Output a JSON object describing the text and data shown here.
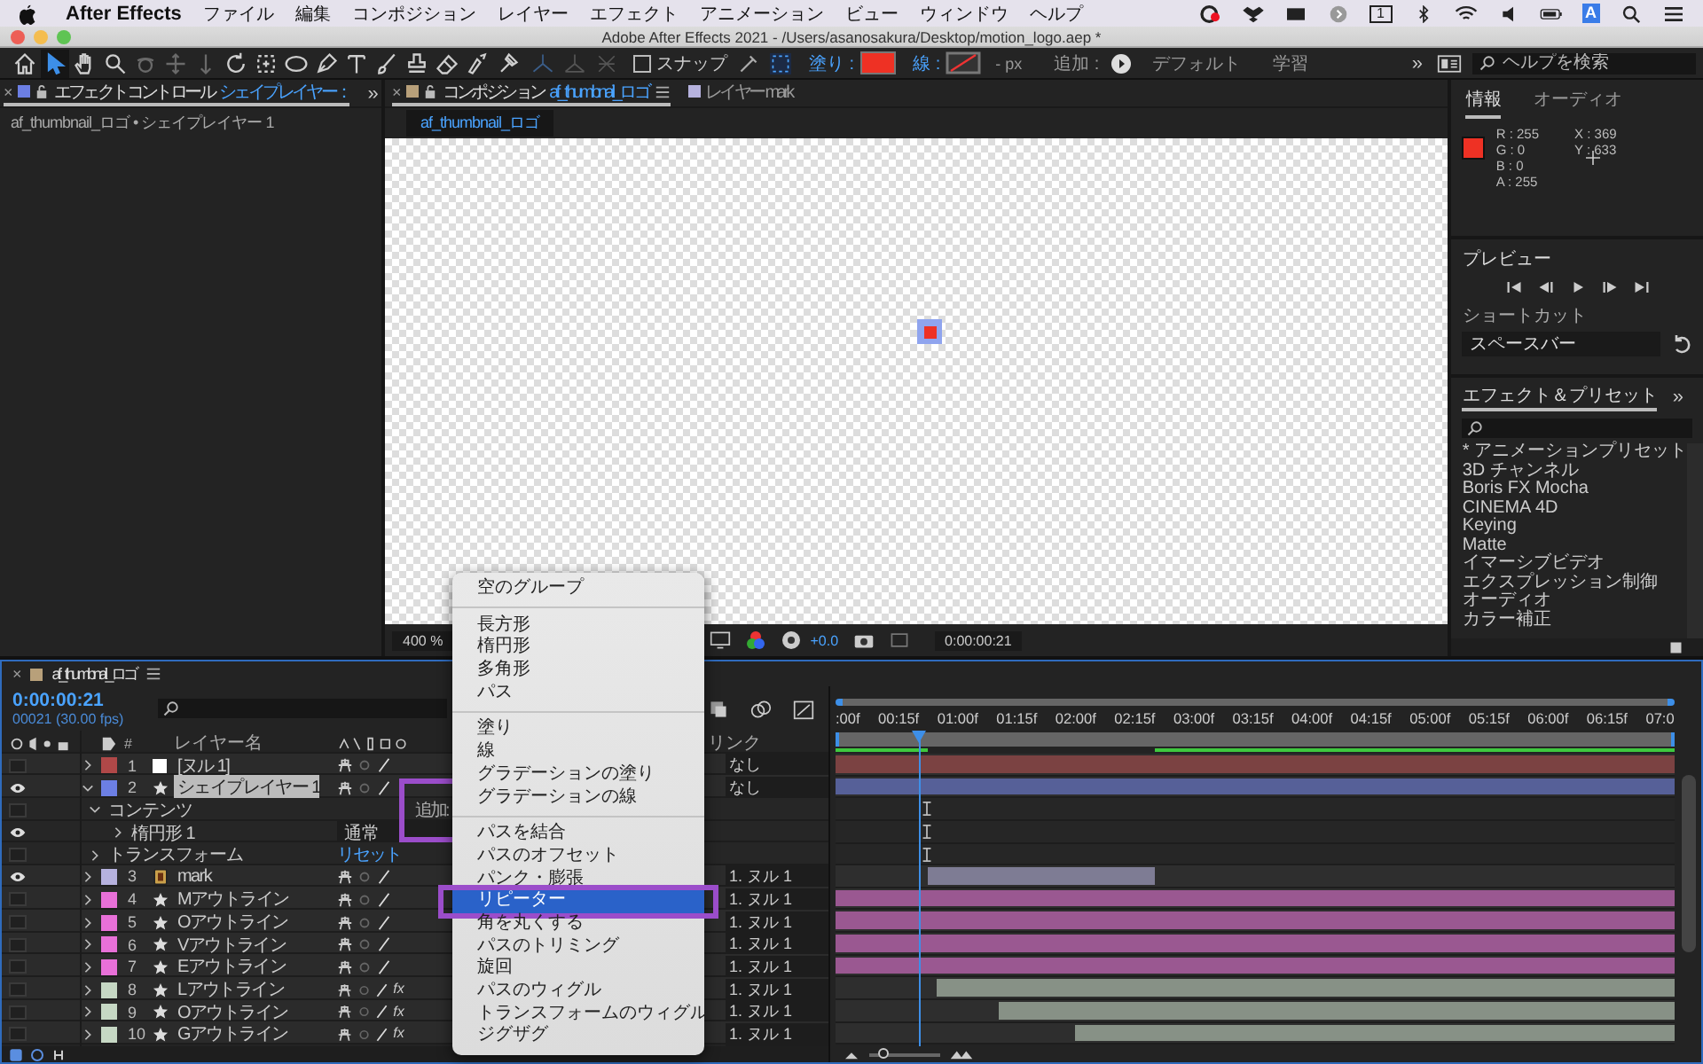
{
  "menubar": {
    "app": "After Effects",
    "menus": [
      "ファイル",
      "編集",
      "コンポジション",
      "レイヤー",
      "エフェクト",
      "アニメーション",
      "ビュー",
      "ウィンドウ",
      "ヘルプ"
    ],
    "display_badge": "1",
    "input_source": "A"
  },
  "window": {
    "title": "Adobe After Effects 2021 - /Users/asanosakura/Desktop/motion_logo.aep *"
  },
  "toolbar": {
    "tools": [
      {
        "kind": "home",
        "selected": false,
        "disabled": false
      },
      {
        "kind": "select",
        "selected": true,
        "disabled": false
      },
      {
        "kind": "hand",
        "selected": false,
        "disabled": false
      },
      {
        "kind": "zoom",
        "selected": false,
        "disabled": false
      },
      {
        "kind": "orbit",
        "selected": false,
        "disabled": true
      },
      {
        "kind": "pan",
        "selected": false,
        "disabled": true
      },
      {
        "kind": "dolly",
        "selected": false,
        "disabled": true
      },
      {
        "kind": "rotate",
        "selected": false,
        "disabled": false
      },
      {
        "kind": "anchor",
        "selected": false,
        "disabled": false
      },
      {
        "kind": "ellipse",
        "selected": false,
        "disabled": false
      },
      {
        "kind": "pen",
        "selected": false,
        "disabled": false
      },
      {
        "kind": "text",
        "selected": false,
        "disabled": false
      },
      {
        "kind": "brush",
        "selected": false,
        "disabled": false
      },
      {
        "kind": "stamp",
        "selected": false,
        "disabled": false
      },
      {
        "kind": "eraser",
        "selected": false,
        "disabled": false
      },
      {
        "kind": "roto",
        "selected": false,
        "disabled": false
      },
      {
        "kind": "puppet",
        "selected": false,
        "disabled": false
      }
    ],
    "snap": {
      "label": "スナップ",
      "checked": false
    },
    "fill": {
      "label": "塗り :",
      "color": "#ee3124"
    },
    "stroke": {
      "label": "線 :",
      "enabled": false
    },
    "stroke_width": "- px",
    "add": {
      "label": "追加 :"
    },
    "workspaces": [
      {
        "label": "デフォルト",
        "selected": false
      },
      {
        "label": "学習",
        "selected": false
      }
    ],
    "more": "»",
    "search": {
      "placeholder": "ヘルプを検索"
    }
  },
  "effect_controls": {
    "tab": {
      "close": "×",
      "title": "エフェクトコントロール",
      "layer": "シェイプレイヤー：",
      "selected": true
    },
    "more": "»",
    "breadcrumb": "af_thumbnail_ロゴ • シェイプレイヤー 1"
  },
  "composition": {
    "tabs": [
      {
        "kind": "composition",
        "close": "×",
        "title": "コンポジション",
        "name": "af_thumbnail_ロゴ",
        "selected": true
      },
      {
        "kind": "layer",
        "title": "レイヤー mark",
        "selected": false
      }
    ],
    "subtab": "af_thumbnail_ロゴ",
    "footer": {
      "zoom": "400 %",
      "exposure": "+0.0",
      "time": "0:00:00:21"
    }
  },
  "info": {
    "tabs": [
      {
        "label": "情報",
        "selected": true
      },
      {
        "label": "オーディオ",
        "selected": false
      }
    ],
    "color": "#ee3124",
    "channels": [
      {
        "label": "R :",
        "value": "255"
      },
      {
        "label": "G :",
        "value": "0"
      },
      {
        "label": "B :",
        "value": "0"
      },
      {
        "label": "A :",
        "value": "255"
      }
    ],
    "position": [
      {
        "label": "X :",
        "value": "369"
      },
      {
        "label": "Y :",
        "value": "633"
      }
    ]
  },
  "preview": {
    "title": "プレビュー",
    "shortcut_label": "ショートカット",
    "shortcut": "スペースバー"
  },
  "effects_presets": {
    "title": "エフェクト＆プリセット",
    "more": "»",
    "items": [
      "* アニメーションプリセット",
      "3D チャンネル",
      "Boris FX Mocha",
      "CINEMA 4D",
      "Keying",
      "Matte",
      "イマーシブビデオ",
      "エクスプレッション制御",
      "オーディオ",
      "カラー補正"
    ]
  },
  "timeline": {
    "tab": {
      "close": "×",
      "name": "af_thumbnail_ロゴ"
    },
    "timecode": "0:00:00:21",
    "frame": "00021 (30.00 fps)",
    "columns": {
      "number": "#",
      "name": "レイヤー名",
      "parent": "リンク"
    },
    "ruler": [
      ":00f",
      "00:15f",
      "01:00f",
      "01:15f",
      "02:00f",
      "02:15f",
      "03:00f",
      "03:15f",
      "04:00f",
      "04:15f",
      "05:00f",
      "05:15f",
      "06:00f",
      "06:15f",
      "07:0"
    ],
    "playhead": {
      "level": 0.1
    },
    "zoom": {
      "level": 0.15
    },
    "layers": [
      {
        "kind": "null",
        "number": "1",
        "color": "#b04848",
        "name": "[ヌル 1]",
        "visible": false,
        "expanded": false,
        "selected": false,
        "parent": "なし"
      },
      {
        "kind": "shape",
        "number": "2",
        "color": "#6c7fe4",
        "name": "シェイプレイヤー 1",
        "visible": true,
        "expanded": true,
        "selected": true,
        "parent": "なし",
        "children": [
          {
            "kind": "group",
            "name": "コンテンツ",
            "visible": false,
            "expanded": true,
            "action": "追加:",
            "highlighted": true,
            "children": [
              {
                "kind": "property",
                "name": "楕円形 1",
                "visible": true,
                "expanded": false,
                "mode": "通常"
              }
            ]
          },
          {
            "kind": "property",
            "name": "トランスフォーム",
            "visible": false,
            "expanded": false,
            "reset": "リセット"
          }
        ]
      },
      {
        "kind": "precomp",
        "number": "3",
        "color": "#b6b2de",
        "name": "mark",
        "visible": true,
        "expanded": false,
        "selected": false,
        "parent": "1. ヌル 1"
      },
      {
        "kind": "shape",
        "number": "4",
        "color": "#e870d8",
        "name": "Mアウトライン",
        "visible": false,
        "expanded": false,
        "selected": false,
        "parent": "1. ヌル 1"
      },
      {
        "kind": "shape",
        "number": "5",
        "color": "#e870d8",
        "name": "Oアウトライン",
        "visible": false,
        "expanded": false,
        "selected": false,
        "parent": "1. ヌル 1"
      },
      {
        "kind": "shape",
        "number": "6",
        "color": "#e870d8",
        "name": "Vアウトライン",
        "visible": false,
        "expanded": false,
        "selected": false,
        "parent": "1. ヌル 1"
      },
      {
        "kind": "shape",
        "number": "7",
        "color": "#e870d8",
        "name": "Eアウトライン",
        "visible": false,
        "expanded": false,
        "selected": false,
        "parent": "1. ヌル 1"
      },
      {
        "kind": "shape",
        "number": "8",
        "color": "#c6d8c4",
        "name": "Lアウトライン",
        "visible": false,
        "expanded": false,
        "selected": false,
        "fx": "fx",
        "parent": "1. ヌル 1"
      },
      {
        "kind": "shape",
        "number": "9",
        "color": "#c6d8c4",
        "name": "Oアウトライン",
        "visible": false,
        "expanded": false,
        "selected": false,
        "fx": "fx",
        "parent": "1. ヌル 1"
      },
      {
        "kind": "shape",
        "number": "10",
        "color": "#c6d8c4",
        "name": "Gアウトライン",
        "visible": false,
        "expanded": false,
        "selected": false,
        "fx": "fx",
        "parent": "1. ヌル 1"
      }
    ]
  },
  "context_menu": {
    "sections": [
      {
        "items": [
          {
            "label": "空のグループ",
            "selected": false,
            "highlighted": false
          }
        ]
      },
      {
        "items": [
          {
            "label": "長方形",
            "selected": false,
            "highlighted": false
          },
          {
            "label": "楕円形",
            "selected": false,
            "highlighted": false
          },
          {
            "label": "多角形",
            "selected": false,
            "highlighted": false
          },
          {
            "label": "パス",
            "selected": false,
            "highlighted": false
          }
        ]
      },
      {
        "items": [
          {
            "label": "塗り",
            "selected": false,
            "highlighted": false
          },
          {
            "label": "線",
            "selected": false,
            "highlighted": false
          },
          {
            "label": "グラデーションの塗り",
            "selected": false,
            "highlighted": false
          },
          {
            "label": "グラデーションの線",
            "selected": false,
            "highlighted": false
          }
        ]
      },
      {
        "items": [
          {
            "label": "パスを結合",
            "selected": false,
            "highlighted": false
          },
          {
            "label": "パスのオフセット",
            "selected": false,
            "highlighted": false
          },
          {
            "label": "パンク・膨張",
            "selected": false,
            "highlighted": false
          },
          {
            "label": "リピーター",
            "selected": true,
            "highlighted": true
          },
          {
            "label": "角を丸くする",
            "selected": false,
            "highlighted": false
          },
          {
            "label": "パスのトリミング",
            "selected": false,
            "highlighted": false
          },
          {
            "label": "旋回",
            "selected": false,
            "highlighted": false
          },
          {
            "label": "パスのウィグル",
            "selected": false,
            "highlighted": false
          },
          {
            "label": "トランスフォームのウィグル",
            "selected": false,
            "highlighted": false
          },
          {
            "label": "ジグザグ",
            "selected": false,
            "highlighted": false
          }
        ]
      }
    ]
  }
}
